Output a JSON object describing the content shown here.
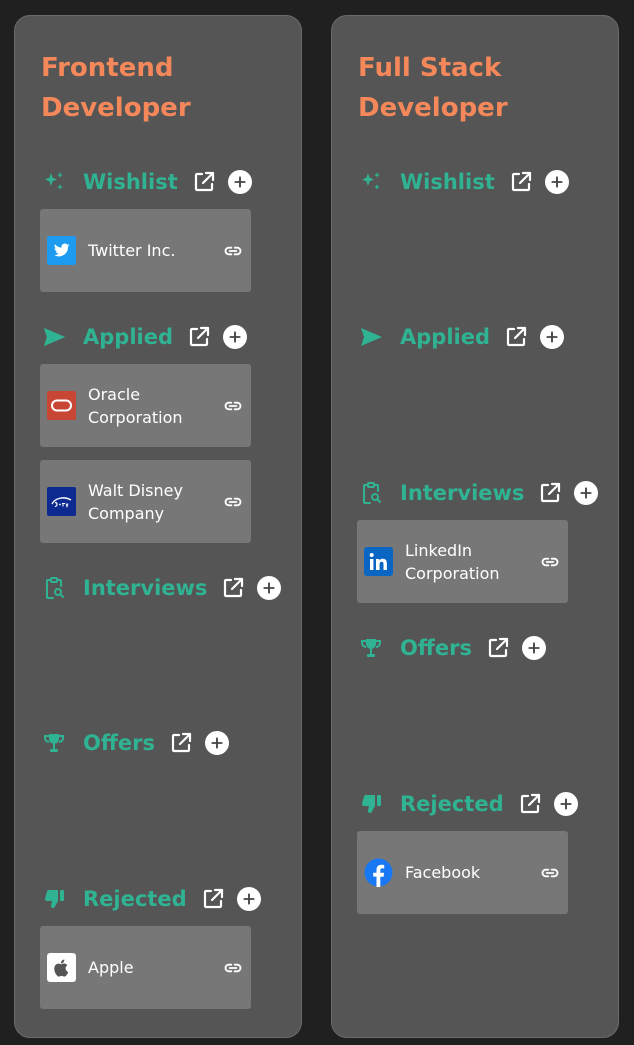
{
  "boards": [
    {
      "title": "Frontend Developer",
      "sections": {
        "wishlist": {
          "label": "Wishlist"
        },
        "applied": {
          "label": "Applied"
        },
        "interviews": {
          "label": "Interviews"
        },
        "offers": {
          "label": "Offers"
        },
        "rejected": {
          "label": "Rejected"
        }
      },
      "cards": {
        "twitter": {
          "name": "Twitter Inc."
        },
        "oracle": {
          "name": "Oracle Corporation"
        },
        "disney": {
          "name": "Walt Disney Company"
        },
        "apple": {
          "name": "Apple"
        }
      }
    },
    {
      "title": "Full Stack Developer",
      "sections": {
        "wishlist": {
          "label": "Wishlist"
        },
        "applied": {
          "label": "Applied"
        },
        "interviews": {
          "label": "Interviews"
        },
        "offers": {
          "label": "Offers"
        },
        "rejected": {
          "label": "Rejected"
        }
      },
      "cards": {
        "linkedin": {
          "name": "LinkedIn Corporation"
        },
        "facebook": {
          "name": "Facebook"
        }
      }
    }
  ],
  "colors": {
    "page_background": "#202020",
    "board_background": "#555555",
    "title_color": "#f5885a",
    "section_color": "#2fb393",
    "card_background": "#777777"
  },
  "icons": {
    "wishlist": "sparkles-icon",
    "applied": "send-icon",
    "interviews": "clipboard-search-icon",
    "offers": "trophy-icon",
    "rejected": "thumbs-down-icon",
    "open": "external-link-icon",
    "add": "plus-circle-icon",
    "card_link": "link-icon"
  }
}
